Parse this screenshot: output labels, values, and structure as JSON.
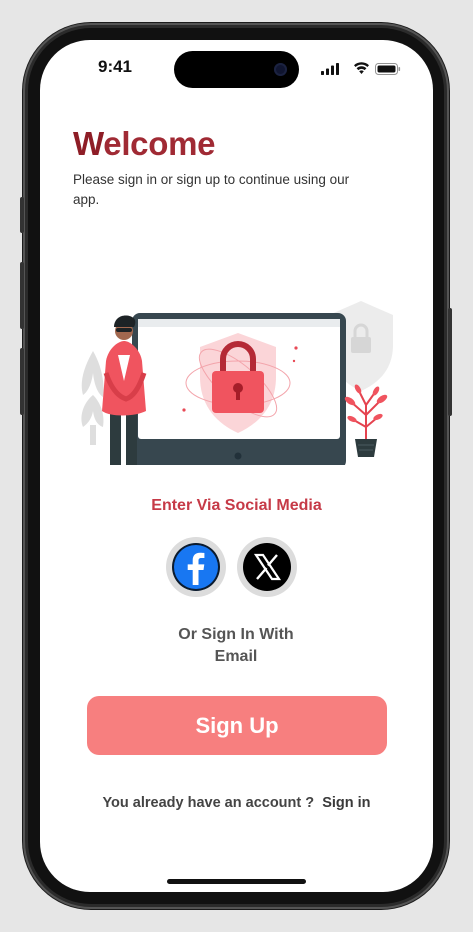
{
  "status_bar": {
    "time": "9:41"
  },
  "welcome": {
    "first_letter": "W",
    "rest": "elcome"
  },
  "subtitle": "Please sign in or sign up to continue using our app.",
  "social": {
    "title": "Enter Via Social Media",
    "providers": [
      "facebook-icon",
      "x-icon"
    ]
  },
  "or_text": {
    "line1": "Or Sign In With",
    "line2": "Email"
  },
  "signup": {
    "label": "Sign Up"
  },
  "account": {
    "prompt": "You already have an account ?",
    "link": "Sign in"
  },
  "colors": {
    "accent": "#f77f7f",
    "title": "#a02a34",
    "social_title": "#c63a47",
    "facebook": "#1877f2"
  }
}
